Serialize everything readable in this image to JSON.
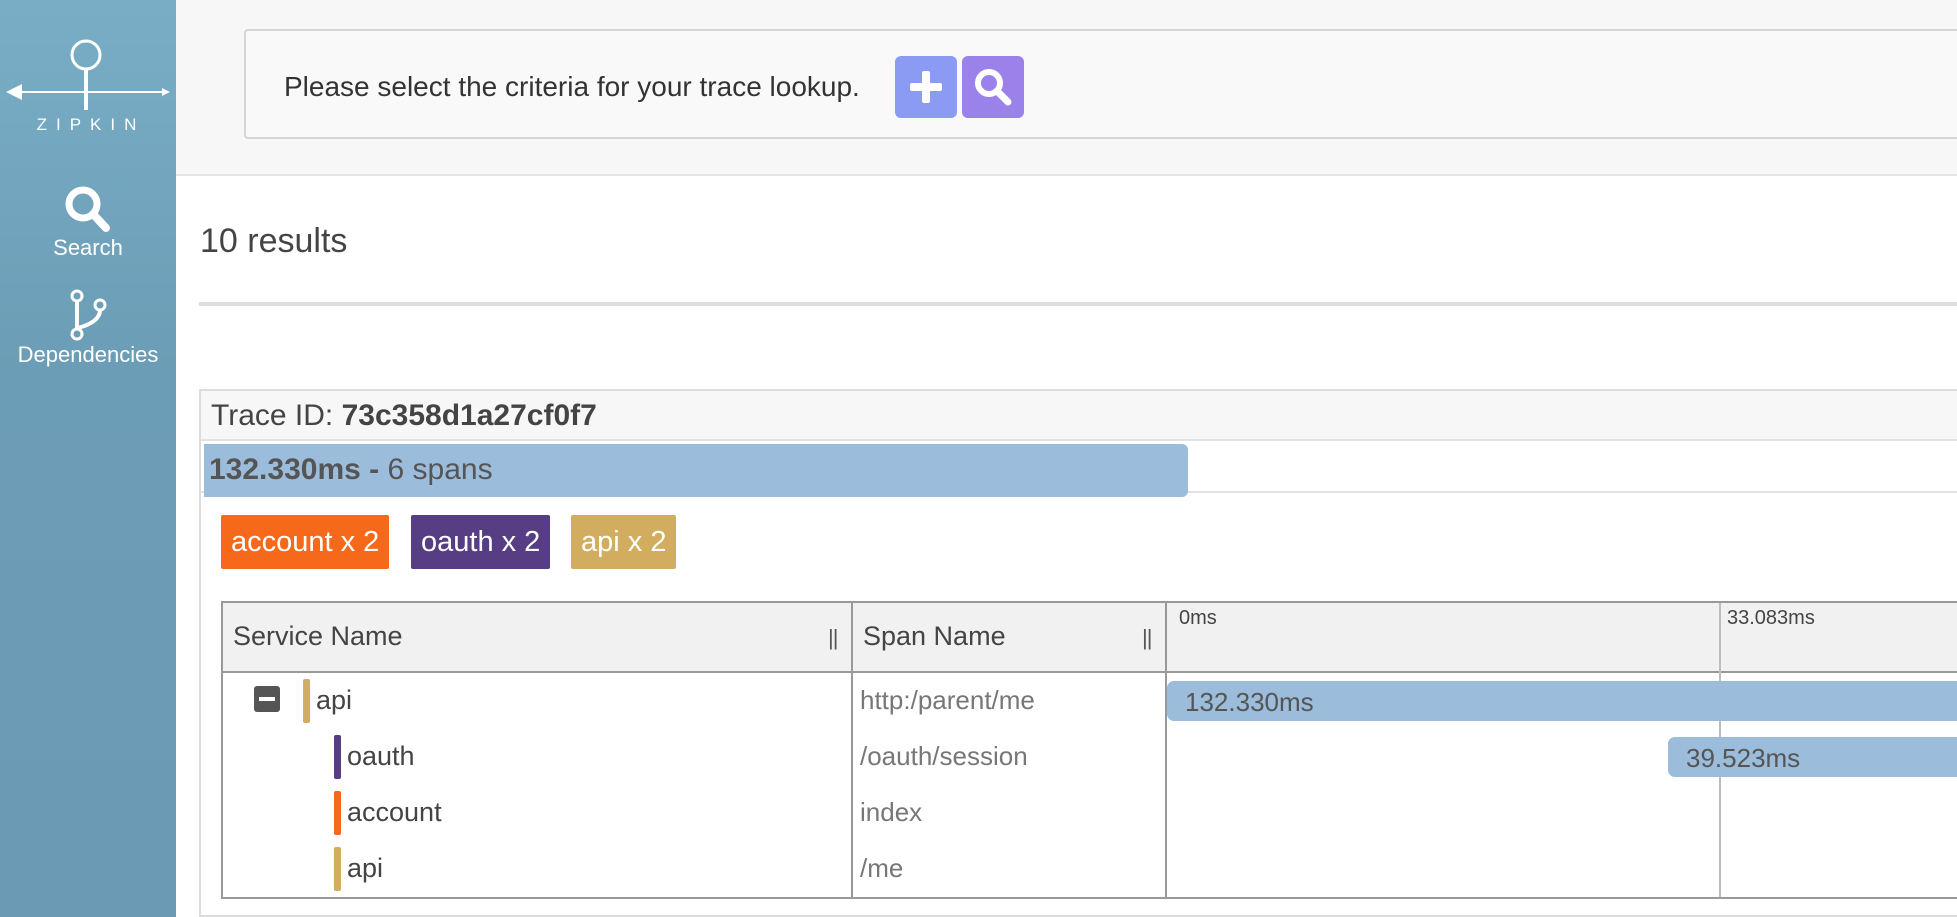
{
  "sidebar": {
    "logo_text": "ZIPKIN",
    "nav": [
      {
        "label": "Search",
        "icon": "search-icon"
      },
      {
        "label": "Dependencies",
        "icon": "dependencies-icon"
      }
    ]
  },
  "search": {
    "criteria_text": "Please select the criteria for your trace lookup.",
    "add_button_icon": "plus-icon",
    "search_button_icon": "search-icon"
  },
  "results": {
    "count_label": "10 results"
  },
  "trace": {
    "id_label": "Trace ID:",
    "id_value": "73c358d1a27cf0f7",
    "duration": "132.330ms",
    "separator": "-",
    "spans_label": "6 spans",
    "badges": [
      {
        "label": "account x 2",
        "color": "#f6681a"
      },
      {
        "label": "oauth x 2",
        "color": "#573d83"
      },
      {
        "label": "api x 2",
        "color": "#d2ad5f"
      }
    ],
    "table": {
      "headers": {
        "service": "Service Name",
        "span": "Span Name",
        "handle": "||"
      },
      "ticks": [
        "0ms",
        "33.083ms"
      ],
      "rows": [
        {
          "service": "api",
          "span": "http:/parent/me",
          "duration": "132.330ms",
          "color": "#d2ad5f"
        },
        {
          "service": "oauth",
          "span": "/oauth/session",
          "duration": "39.523ms",
          "color": "#573d83"
        },
        {
          "service": "account",
          "span": "index",
          "duration": "",
          "color": "#f6681a"
        },
        {
          "service": "api",
          "span": "/me",
          "duration": "",
          "color": "#d2ad5f"
        }
      ]
    }
  },
  "colors": {
    "sidebar": "#6c9db6",
    "add_button": "#8b9af2",
    "search_button": "#9a82ea",
    "duration_bar": "#9bbcda"
  }
}
